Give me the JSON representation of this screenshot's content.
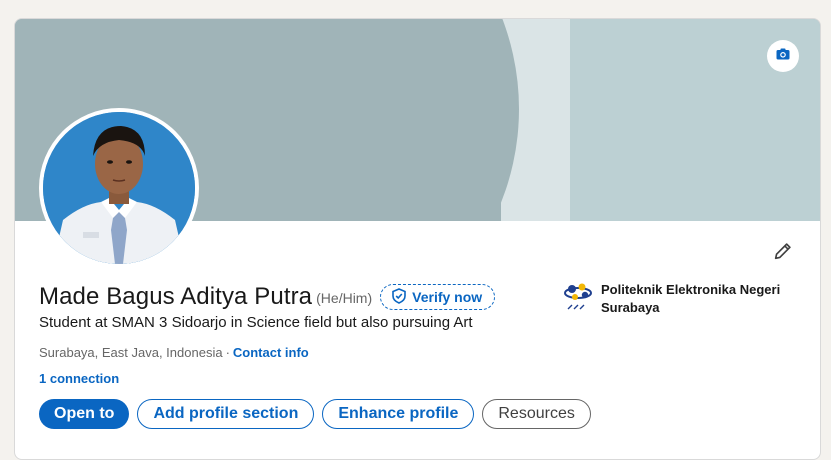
{
  "profile": {
    "name": "Made Bagus Aditya Putra",
    "pronouns": "(He/Him)",
    "verify_label": "Verify now",
    "headline": "Student at SMAN 3 Sidoarjo in Science field but also pursuing Art",
    "location": "Surabaya, East Java, Indonesia",
    "separator": "·",
    "contact_label": "Contact info",
    "connections": "1 connection"
  },
  "education": {
    "school": "Politeknik Elektronika Negeri Surabaya"
  },
  "actions": {
    "open_to": "Open to",
    "add_section": "Add profile section",
    "enhance": "Enhance profile",
    "resources": "Resources"
  },
  "icons": {
    "camera": "camera-icon",
    "edit": "pencil-icon",
    "verify": "shield-check-icon",
    "school_logo": "pens-logo"
  },
  "colors": {
    "accent": "#0a66c2",
    "banner": "#a0b4b8",
    "banner_band_light": "#dae4e6",
    "banner_band_mid": "#bcd0d3"
  }
}
